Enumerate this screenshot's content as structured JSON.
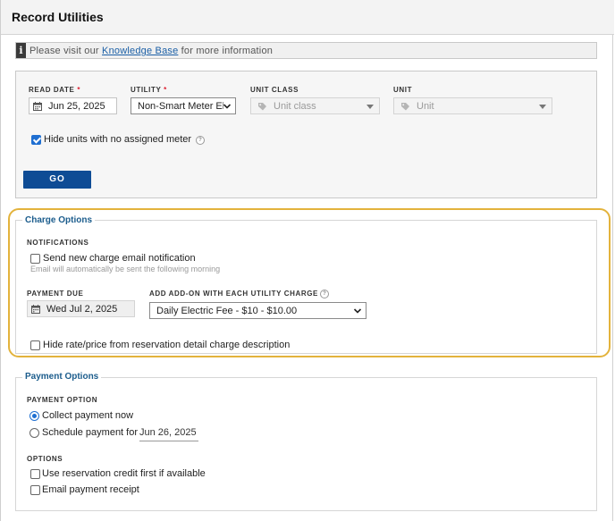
{
  "header": {
    "title": "Record Utilities"
  },
  "info_bar": {
    "icon": "info-icon",
    "prefix": "Please visit our ",
    "link": "Knowledge Base",
    "suffix": " for more information"
  },
  "filters": {
    "read_date": {
      "label": "READ DATE",
      "required_mark": "*",
      "value": "Jun 25, 2025",
      "icon": "calendar-icon"
    },
    "utility": {
      "label": "UTILITY",
      "required_mark": "*",
      "value": "Non-Smart Meter Ele"
    },
    "unit_class": {
      "label": "UNIT CLASS",
      "placeholder": "Unit class",
      "icon": "tag-icon"
    },
    "unit": {
      "label": "UNIT",
      "placeholder": "Unit",
      "icon": "tag-icon"
    },
    "hide_units": {
      "label": "Hide units with no assigned meter",
      "checked": true
    },
    "go_label": "GO"
  },
  "charge_options": {
    "legend": "Charge Options",
    "notifications_label": "NOTIFICATIONS",
    "send_notification": {
      "label": "Send new charge email notification",
      "checked": false
    },
    "notification_hint": "Email will automatically be sent the following morning",
    "payment_due": {
      "label": "PAYMENT DUE",
      "value": "Wed Jul 2, 2025"
    },
    "add_on": {
      "label": "ADD ADD-ON WITH EACH UTILITY CHARGE",
      "value": "Daily Electric Fee - $10 - $10.00"
    },
    "hide_rate": {
      "label": "Hide rate/price from reservation detail charge description",
      "checked": false
    }
  },
  "payment_options": {
    "legend": "Payment Options",
    "payment_option_label": "PAYMENT OPTION",
    "collect_now": {
      "label": "Collect payment now",
      "checked": true
    },
    "schedule": {
      "label": "Schedule payment for",
      "date": "Jun 26, 2025",
      "checked": false
    },
    "options_label": "OPTIONS",
    "use_credit": {
      "label": "Use reservation credit first if available",
      "checked": false
    },
    "email_receipt": {
      "label": "Email payment receipt",
      "checked": false
    }
  },
  "colors": {
    "accent": "#0e4c95",
    "highlight": "#e3b33c",
    "legend": "#1b5c8c",
    "checkbox": "#1f6fd1"
  }
}
